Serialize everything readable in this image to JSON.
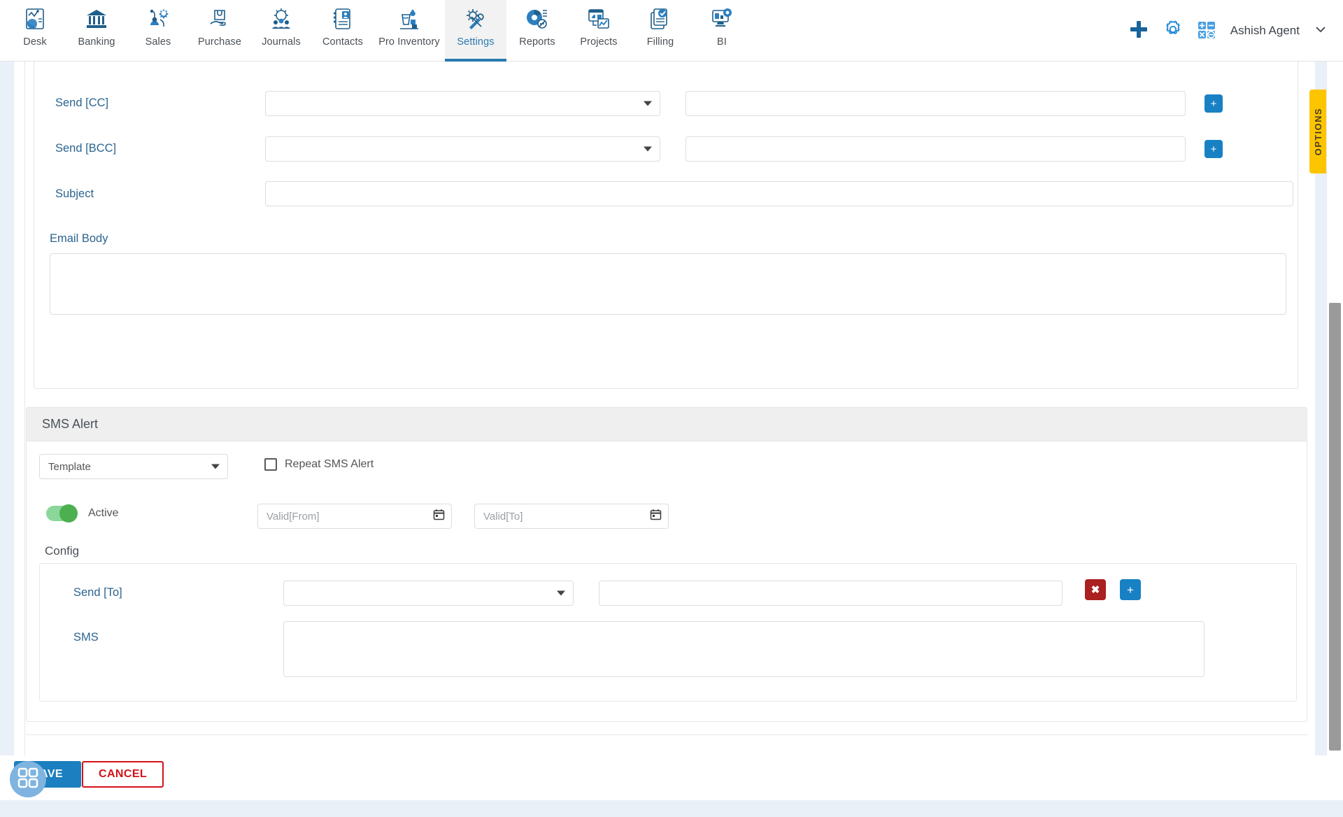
{
  "nav": {
    "items": [
      {
        "label": "Desk",
        "icon": "desk-icon",
        "active": false
      },
      {
        "label": "Banking",
        "icon": "bank-icon",
        "active": false
      },
      {
        "label": "Sales",
        "icon": "sales-icon",
        "active": false
      },
      {
        "label": "Purchase",
        "icon": "purchase-icon",
        "active": false
      },
      {
        "label": "Journals",
        "icon": "journals-icon",
        "active": false
      },
      {
        "label": "Contacts",
        "icon": "contacts-icon",
        "active": false
      },
      {
        "label": "Pro Inventory",
        "icon": "inventory-icon",
        "active": false
      },
      {
        "label": "Settings",
        "icon": "settings-icon",
        "active": true
      },
      {
        "label": "Reports",
        "icon": "reports-icon",
        "active": false
      },
      {
        "label": "Projects",
        "icon": "projects-icon",
        "active": false
      },
      {
        "label": "Filling",
        "icon": "filling-icon",
        "active": false
      },
      {
        "label": "BI",
        "icon": "bi-icon",
        "active": false
      }
    ],
    "actions": {
      "add": "add-icon",
      "settings": "gear-icon",
      "calculator": "calculator-icon"
    },
    "user": {
      "name": "Ashish Agent",
      "chevron": "chevron-down-icon"
    }
  },
  "options_tab": {
    "label": "OPTIONS"
  },
  "email_section": {
    "rows": [
      {
        "label": "Send [CC]",
        "select_value": "",
        "text_value": "",
        "add_label": "+"
      },
      {
        "label": "Send [BCC]",
        "select_value": "",
        "text_value": "",
        "add_label": "+"
      }
    ],
    "subject": {
      "label": "Subject",
      "value": "",
      "placeholder": ""
    },
    "email_body": {
      "label": "Email Body",
      "value": "",
      "placeholder": ""
    }
  },
  "sms_section": {
    "title": "SMS Alert",
    "template": {
      "value": "Template",
      "placeholder": "Template"
    },
    "repeat": {
      "label": "Repeat SMS Alert",
      "checked": false
    },
    "active": {
      "label": "Active",
      "on": true
    },
    "valid_from": {
      "placeholder": "Valid[From]",
      "value": "",
      "icon": "calendar-icon"
    },
    "valid_to": {
      "placeholder": "Valid[To]",
      "value": "",
      "icon": "calendar-icon"
    },
    "config": {
      "title": "Config",
      "send_to": {
        "label": "Send [To]",
        "select_value": "",
        "text_value": "",
        "delete_label": "✖",
        "add_label": "+"
      },
      "sms": {
        "label": "SMS",
        "value": "",
        "placeholder": ""
      }
    }
  },
  "footer": {
    "save_label": "SAVE",
    "cancel_label": "CANCEL",
    "fab_icon": "apps-grid-icon"
  },
  "colors": {
    "brand_blue": "#1b7fc0",
    "label_blue": "#2c6490",
    "danger_red": "#d4111a",
    "delete_red": "#ab2020",
    "toggle_green": "#4caf50",
    "options_yellow": "#fdc500",
    "header_gray": "#efefef"
  }
}
